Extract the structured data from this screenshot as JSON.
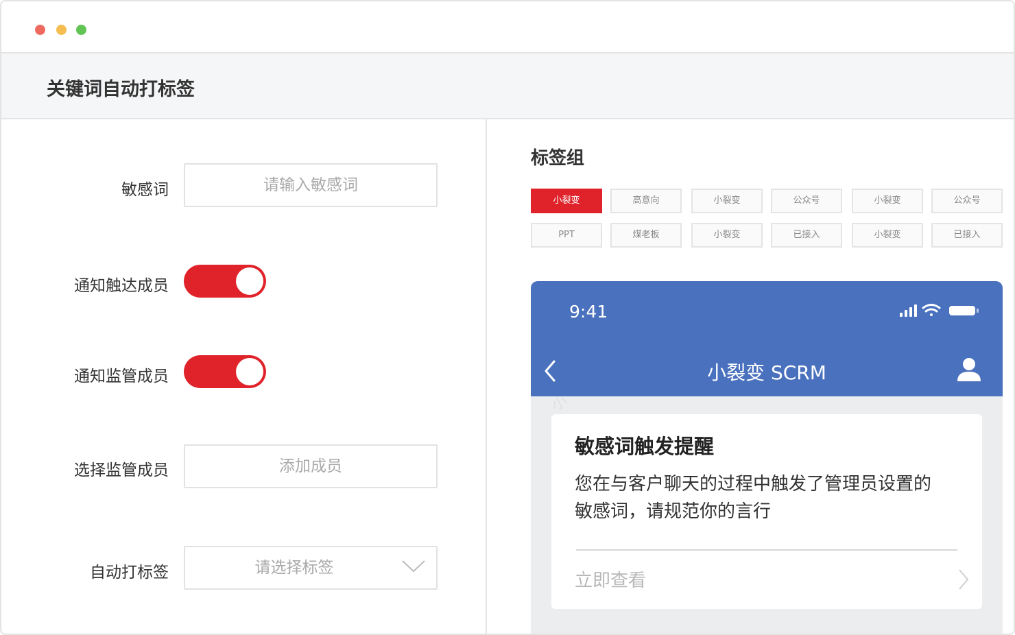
{
  "header": {
    "title": "关键词自动打标签"
  },
  "form": {
    "sensitive_label": "敏感词",
    "sensitive_placeholder": "请输入敏感词",
    "notify_reach_label": "通知触达成员",
    "notify_reach_on": true,
    "notify_supervisor_label": "通知监管成员",
    "notify_supervisor_on": true,
    "select_supervisor_label": "选择监管成员",
    "select_supervisor_placeholder": "添加成员",
    "auto_tag_label": "自动打标签",
    "auto_tag_placeholder": "请选择标签"
  },
  "tags": {
    "title": "标签组",
    "row1": [
      "小裂变",
      "高意向",
      "小裂变",
      "公众号",
      "小裂变",
      "公众号"
    ],
    "row2": [
      "PPT",
      "煤老板",
      "小裂变",
      "已接入",
      "小裂变",
      "已接入"
    ],
    "active_index": 0
  },
  "phone": {
    "time": "9:41",
    "nav_title": "小裂变 SCRM",
    "card_title": "敏感词触发提醒",
    "card_body_line1": "您在与客户聊天的过程中触发了管理员设置的",
    "card_body_line2": "敏感词，请规范你的言行",
    "card_link": "立即查看"
  },
  "colors": {
    "accent": "#e0232b",
    "phone_blue": "#4a71be"
  }
}
